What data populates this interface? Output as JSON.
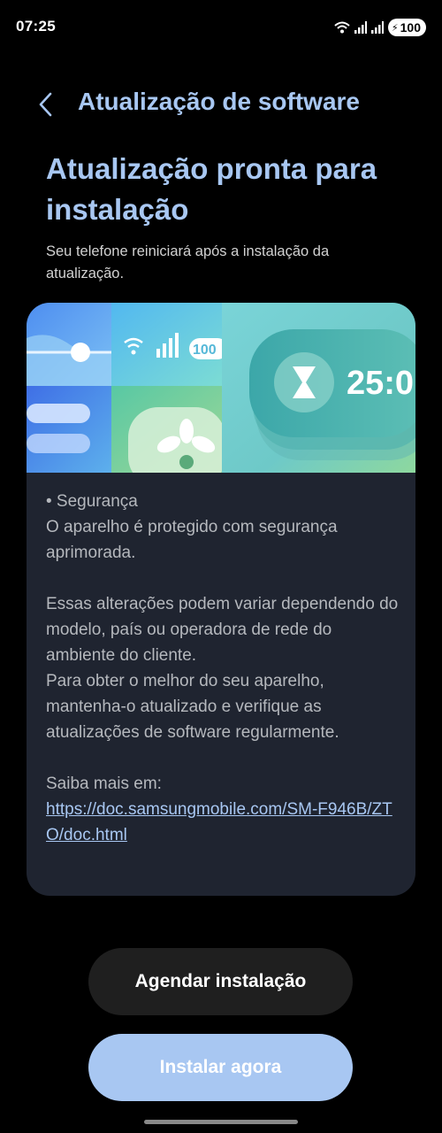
{
  "status_bar": {
    "time": "07:25",
    "battery": "100"
  },
  "header": {
    "title": "Atualização de software",
    "back_icon": "chevron-left-icon"
  },
  "main": {
    "title": "Atualização pronta para instalação",
    "subtitle": "Seu telefone reiniciará após a instalação da atualização."
  },
  "banner": {
    "status_battery": "100",
    "timer_text": "25:0"
  },
  "notes": {
    "bullet": "• Segurança",
    "security_text": "O aparelho é protegido com segurança aprimorada.",
    "variation_text": "Essas alterações podem variar dependendo do modelo, país ou operadora de rede do ambiente do cliente.",
    "advice_text": "Para obter o melhor do seu aparelho, mantenha-o atualizado e verifique as atualizações de software regularmente.",
    "learn_more_label": "Saiba mais em:",
    "learn_more_link": "https://doc.samsungmobile.com/SM-F946B/ZTO/doc.html"
  },
  "buttons": {
    "schedule_label": "Agendar instalação",
    "install_label": "Instalar agora"
  },
  "colors": {
    "accent": "#a8c7f2",
    "card_bg": "#1f2430",
    "background": "#000000"
  }
}
